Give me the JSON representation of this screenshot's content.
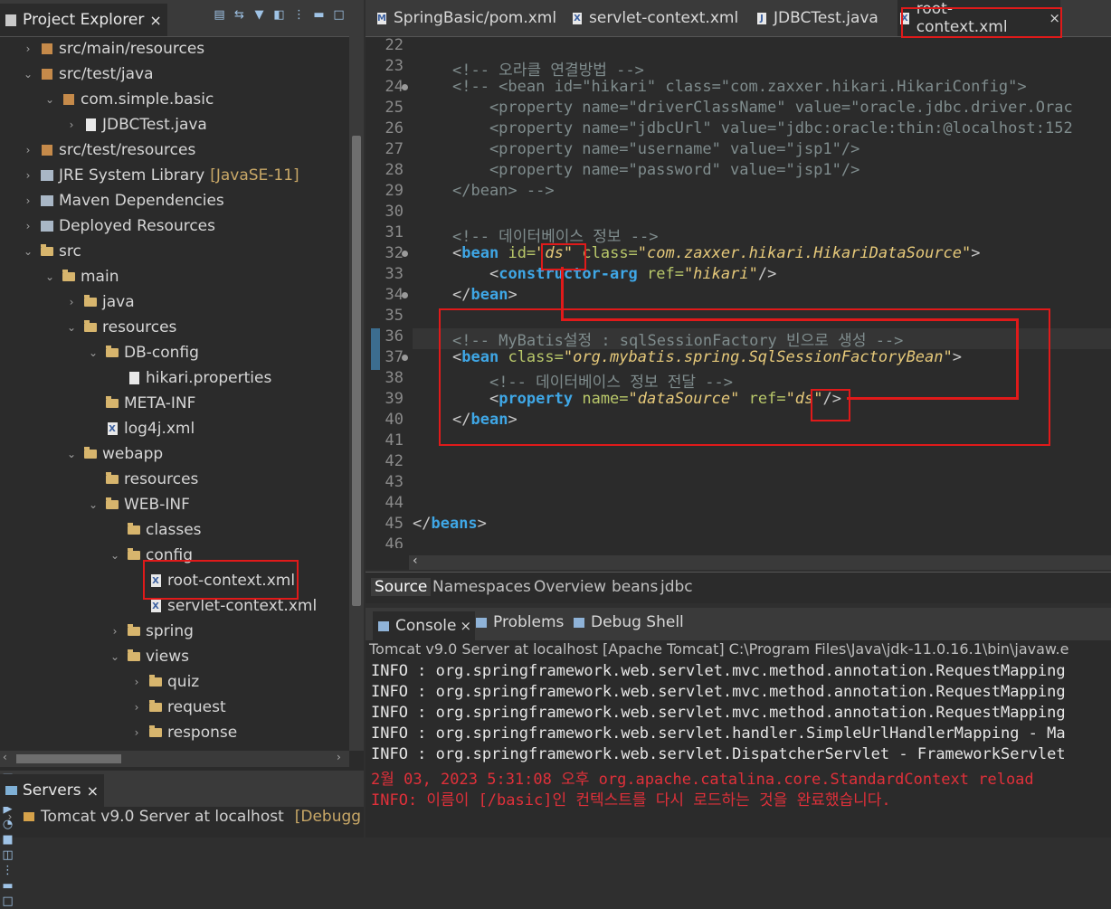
{
  "left_panel": {
    "tab_label": "Project Explorer",
    "close": "×",
    "tree": [
      {
        "label": "src/main/resources",
        "indent": 1,
        "arrow": "›",
        "icon": "pkg"
      },
      {
        "label": "src/test/java",
        "indent": 1,
        "arrow": "⌄",
        "icon": "pkg"
      },
      {
        "label": "com.simple.basic",
        "indent": 2,
        "arrow": "⌄",
        "icon": "pkg"
      },
      {
        "label": "JDBCTest.java",
        "indent": 3,
        "arrow": "›",
        "icon": "file"
      },
      {
        "label": "src/test/resources",
        "indent": 1,
        "arrow": "›",
        "icon": "pkg"
      },
      {
        "label": "JRE System Library",
        "extra": "[JavaSE-11]",
        "indent": 1,
        "arrow": "›",
        "icon": "lib"
      },
      {
        "label": "Maven Dependencies",
        "indent": 1,
        "arrow": "›",
        "icon": "lib"
      },
      {
        "label": "Deployed Resources",
        "indent": 1,
        "arrow": "›",
        "icon": "lib"
      },
      {
        "label": "src",
        "indent": 1,
        "arrow": "⌄",
        "icon": "folder"
      },
      {
        "label": "main",
        "indent": 2,
        "arrow": "⌄",
        "icon": "folder"
      },
      {
        "label": "java",
        "indent": 3,
        "arrow": "›",
        "icon": "folder"
      },
      {
        "label": "resources",
        "indent": 3,
        "arrow": "⌄",
        "icon": "folder"
      },
      {
        "label": "DB-config",
        "indent": 4,
        "arrow": "⌄",
        "icon": "folder"
      },
      {
        "label": "hikari.properties",
        "indent": 5,
        "arrow": "",
        "icon": "file"
      },
      {
        "label": "META-INF",
        "indent": 4,
        "arrow": "",
        "icon": "folder"
      },
      {
        "label": "log4j.xml",
        "indent": 4,
        "arrow": "",
        "icon": "xml"
      },
      {
        "label": "webapp",
        "indent": 3,
        "arrow": "⌄",
        "icon": "folder"
      },
      {
        "label": "resources",
        "indent": 4,
        "arrow": "",
        "icon": "folder"
      },
      {
        "label": "WEB-INF",
        "indent": 4,
        "arrow": "⌄",
        "icon": "folder"
      },
      {
        "label": "classes",
        "indent": 5,
        "arrow": "",
        "icon": "folder"
      },
      {
        "label": "config",
        "indent": 5,
        "arrow": "⌄",
        "icon": "folder"
      },
      {
        "label": "root-context.xml",
        "indent": 6,
        "arrow": "",
        "icon": "xml"
      },
      {
        "label": "servlet-context.xml",
        "indent": 6,
        "arrow": "",
        "icon": "xml"
      },
      {
        "label": "spring",
        "indent": 5,
        "arrow": "›",
        "icon": "folder"
      },
      {
        "label": "views",
        "indent": 5,
        "arrow": "⌄",
        "icon": "folder"
      },
      {
        "label": "quiz",
        "indent": 6,
        "arrow": "›",
        "icon": "folder"
      },
      {
        "label": "request",
        "indent": 6,
        "arrow": "›",
        "icon": "folder"
      },
      {
        "label": "response",
        "indent": 6,
        "arrow": "›",
        "icon": "folder"
      }
    ]
  },
  "servers_panel": {
    "tab_label": "Servers",
    "close": "×",
    "server": "Tomcat v9.0 Server at localhost",
    "state": "[Debugg"
  },
  "editor": {
    "tabs": [
      {
        "label": "SpringBasic/pom.xml",
        "icon": "m"
      },
      {
        "label": "servlet-context.xml",
        "icon": "x"
      },
      {
        "label": "JDBCTest.java",
        "icon": "j"
      },
      {
        "label": "root-context.xml",
        "icon": "x",
        "active": true,
        "close": "×"
      }
    ],
    "lines": [
      {
        "n": "22",
        "html": ""
      },
      {
        "n": "23",
        "html": "<span class='c-com'>&lt;!-- 오라클 연결방법 --&gt;</span>"
      },
      {
        "n": "24",
        "fold": true,
        "html": "<span class='c-com'>&lt;!-- &lt;bean id=\"hikari\" class=\"com.zaxxer.hikari.HikariConfig\"&gt;</span>"
      },
      {
        "n": "25",
        "html": "<span class='c-com'>    &lt;property name=\"driverClassName\" value=\"oracle.jdbc.driver.Orac</span>"
      },
      {
        "n": "26",
        "html": "<span class='c-com'>    &lt;property name=\"jdbcUrl\" value=\"jdbc:oracle:thin:@localhost:152</span>"
      },
      {
        "n": "27",
        "html": "<span class='c-com'>    &lt;property name=\"username\" value=\"jsp1\"/&gt;</span>"
      },
      {
        "n": "28",
        "html": "<span class='c-com'>    &lt;property name=\"password\" value=\"jsp1\"/&gt;</span>"
      },
      {
        "n": "29",
        "html": "<span class='c-com'>&lt;/bean&gt; --&gt;</span>"
      },
      {
        "n": "30",
        "html": ""
      },
      {
        "n": "31",
        "html": "<span class='c-com'>&lt;!-- 데이터베이스 정보 --&gt;</span>"
      },
      {
        "n": "32",
        "fold": true,
        "html": "<span class='c-pl'>&lt;</span><span class='c-kw'>bean</span> <span class='c-at'>id=</span><span class='c-val'>\"ds\"</span> <span class='c-at'>class=</span><span class='c-val'>\"com.zaxxer.hikari.HikariDataSource\"</span><span class='c-pl'>&gt;</span>"
      },
      {
        "n": "33",
        "html": "    <span class='c-pl'>&lt;</span><span class='c-kw'>constructor-arg</span> <span class='c-at'>ref=</span><span class='c-val'>\"hikari\"</span><span class='c-pl'>/&gt;</span>"
      },
      {
        "n": "34",
        "fold": true,
        "html": "<span class='c-pl'>&lt;/</span><span class='c-kw'>bean</span><span class='c-pl'>&gt;</span>"
      },
      {
        "n": "35",
        "html": ""
      },
      {
        "n": "36",
        "cur": true,
        "html": "<span class='c-com'>&lt;!-- MyBatis설정 : sqlSessionFactory 빈으로 생성 --&gt;</span>"
      },
      {
        "n": "37",
        "fold": true,
        "html": "<span class='c-pl'>&lt;</span><span class='c-kw'>bean</span> <span class='c-at'>class=</span><span class='c-val'>\"org.mybatis.spring.SqlSessionFactoryBean\"</span><span class='c-pl'>&gt;</span>"
      },
      {
        "n": "38",
        "html": "    <span class='c-com'>&lt;!-- 데이터베이스 정보 전달 --&gt;</span>"
      },
      {
        "n": "39",
        "html": "    <span class='c-pl'>&lt;</span><span class='c-kw'>property</span> <span class='c-at'>name=</span><span class='c-val'>\"dataSource\"</span> <span class='c-at'>ref=</span><span class='c-val'>\"ds\"</span><span class='c-pl'>/&gt;</span>"
      },
      {
        "n": "40",
        "html": "<span class='c-pl'>&lt;/</span><span class='c-kw'>bean</span><span class='c-pl'>&gt;</span>"
      },
      {
        "n": "41",
        "html": ""
      },
      {
        "n": "42",
        "html": ""
      },
      {
        "n": "43",
        "html": ""
      },
      {
        "n": "44",
        "html": ""
      },
      {
        "n": "45",
        "outdent": true,
        "html": "<span class='c-pl'>&lt;/</span><span class='c-kw'>beans</span><span class='c-pl'>&gt;</span>"
      },
      {
        "n": "46",
        "html": ""
      }
    ],
    "subtabs": [
      "Source",
      "Namespaces",
      "Overview",
      "beans",
      "jdbc"
    ],
    "hscroll_left": "‹"
  },
  "console": {
    "tabs": [
      {
        "label": "Console",
        "close": "×",
        "active": true
      },
      {
        "label": "Problems"
      },
      {
        "label": "Debug Shell"
      }
    ],
    "title": "Tomcat v9.0 Server at localhost [Apache Tomcat] C:\\Program Files\\Java\\jdk-11.0.16.1\\bin\\javaw.e",
    "lines": [
      {
        "text": "INFO : org.springframework.web.servlet.mvc.method.annotation.RequestMapping",
        "color": "info"
      },
      {
        "text": "INFO : org.springframework.web.servlet.mvc.method.annotation.RequestMapping",
        "color": "info"
      },
      {
        "text": "INFO : org.springframework.web.servlet.mvc.method.annotation.RequestMapping",
        "color": "info"
      },
      {
        "text": "INFO : org.springframework.web.servlet.handler.SimpleUrlHandlerMapping - Ma",
        "color": "info"
      },
      {
        "text": "INFO : org.springframework.web.servlet.DispatcherServlet - FrameworkServlet",
        "color": "info"
      },
      {
        "text": "2월 03, 2023 5:31:08 오후 org.apache.catalina.core.StandardContext reload",
        "color": "red"
      },
      {
        "text": "INFO: 이름이 [/basic]인 컨텍스트를 다시 로드하는 것을 완료했습니다.",
        "color": "red"
      }
    ]
  },
  "colors": {
    "highlight_red": "#e01a1a"
  }
}
